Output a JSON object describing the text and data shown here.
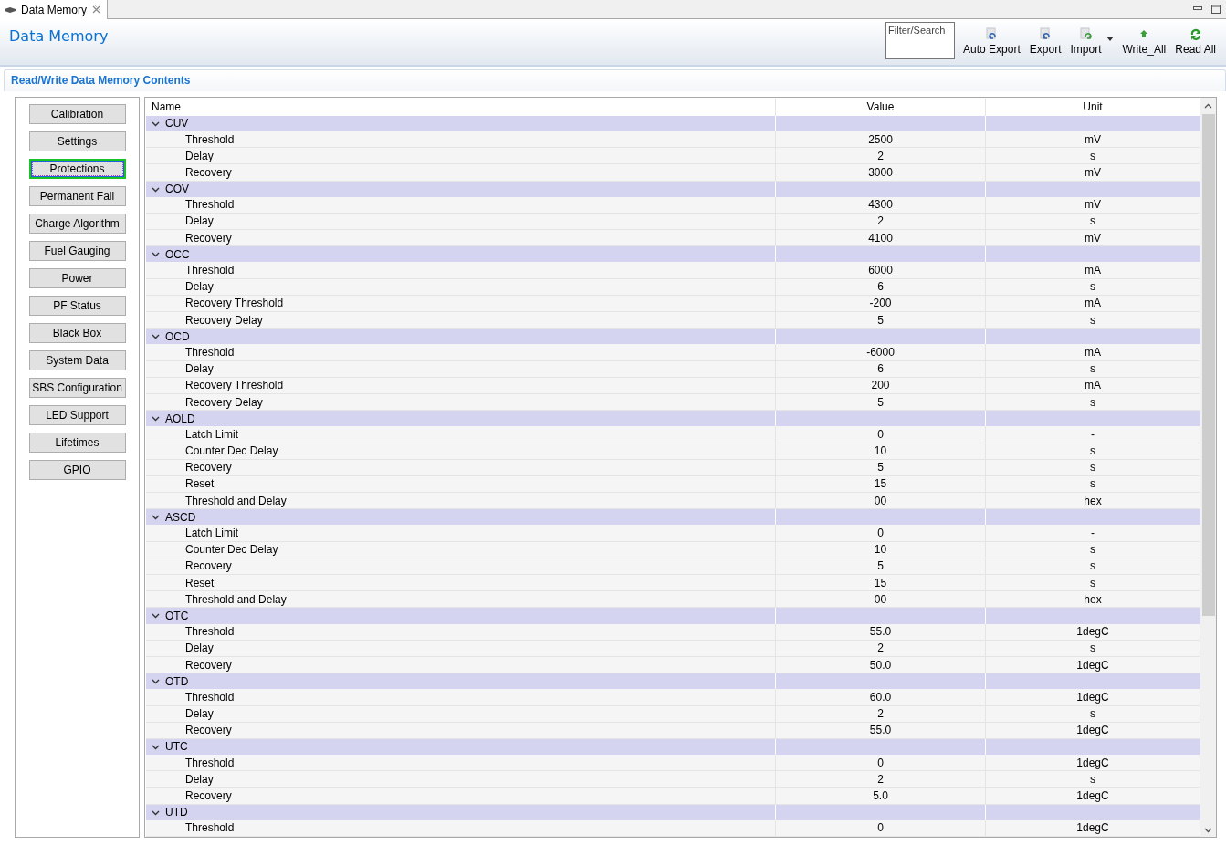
{
  "tab": {
    "title": "Data Memory",
    "selected": true
  },
  "header": {
    "title": "Data Memory"
  },
  "toolbar": {
    "search": {
      "placeholder": "Filter/Search"
    },
    "buttons": [
      {
        "label": "Auto Export",
        "kind": "export",
        "menu": false
      },
      {
        "label": "Export",
        "kind": "export",
        "menu": false
      },
      {
        "label": "Import",
        "kind": "import",
        "menu": true
      },
      {
        "label": "Write_All",
        "kind": "write",
        "menu": false
      },
      {
        "label": "Read All",
        "kind": "read",
        "menu": false
      }
    ]
  },
  "section": {
    "title": "Read/Write Data Memory Contents"
  },
  "sidebar": {
    "items": [
      {
        "label": "Calibration",
        "selected": false
      },
      {
        "label": "Settings",
        "selected": false
      },
      {
        "label": "Protections",
        "selected": true
      },
      {
        "label": "Permanent Fail",
        "selected": false
      },
      {
        "label": "Charge Algorithm",
        "selected": false
      },
      {
        "label": "Fuel Gauging",
        "selected": false
      },
      {
        "label": "Power",
        "selected": false
      },
      {
        "label": "PF Status",
        "selected": false
      },
      {
        "label": "Black Box",
        "selected": false
      },
      {
        "label": "System Data",
        "selected": false
      },
      {
        "label": "SBS Configuration",
        "selected": false
      },
      {
        "label": "LED Support",
        "selected": false
      },
      {
        "label": "Lifetimes",
        "selected": false
      },
      {
        "label": "GPIO",
        "selected": false
      }
    ]
  },
  "table": {
    "columns": [
      "Name",
      "Value",
      "Unit"
    ],
    "groups": [
      {
        "name": "CUV",
        "expanded": true,
        "children": [
          [
            "Threshold",
            "2500",
            "mV"
          ],
          [
            "Delay",
            "2",
            "s"
          ],
          [
            "Recovery",
            "3000",
            "mV"
          ]
        ]
      },
      {
        "name": "COV",
        "expanded": true,
        "children": [
          [
            "Threshold",
            "4300",
            "mV"
          ],
          [
            "Delay",
            "2",
            "s"
          ],
          [
            "Recovery",
            "4100",
            "mV"
          ]
        ]
      },
      {
        "name": "OCC",
        "expanded": true,
        "children": [
          [
            "Threshold",
            "6000",
            "mA"
          ],
          [
            "Delay",
            "6",
            "s"
          ],
          [
            "Recovery Threshold",
            "-200",
            "mA"
          ],
          [
            "Recovery Delay",
            "5",
            "s"
          ]
        ]
      },
      {
        "name": "OCD",
        "expanded": true,
        "children": [
          [
            "Threshold",
            "-6000",
            "mA"
          ],
          [
            "Delay",
            "6",
            "s"
          ],
          [
            "Recovery Threshold",
            "200",
            "mA"
          ],
          [
            "Recovery Delay",
            "5",
            "s"
          ]
        ]
      },
      {
        "name": "AOLD",
        "expanded": true,
        "children": [
          [
            "Latch Limit",
            "0",
            "-"
          ],
          [
            "Counter Dec Delay",
            "10",
            "s"
          ],
          [
            "Recovery",
            "5",
            "s"
          ],
          [
            "Reset",
            "15",
            "s"
          ],
          [
            "Threshold and Delay",
            "00",
            "hex"
          ]
        ]
      },
      {
        "name": "ASCD",
        "expanded": true,
        "children": [
          [
            "Latch Limit",
            "0",
            "-"
          ],
          [
            "Counter Dec Delay",
            "10",
            "s"
          ],
          [
            "Recovery",
            "5",
            "s"
          ],
          [
            "Reset",
            "15",
            "s"
          ],
          [
            "Threshold and Delay",
            "00",
            "hex"
          ]
        ]
      },
      {
        "name": "OTC",
        "expanded": true,
        "children": [
          [
            "Threshold",
            "55.0",
            "1degC"
          ],
          [
            "Delay",
            "2",
            "s"
          ],
          [
            "Recovery",
            "50.0",
            "1degC"
          ]
        ]
      },
      {
        "name": "OTD",
        "expanded": true,
        "children": [
          [
            "Threshold",
            "60.0",
            "1degC"
          ],
          [
            "Delay",
            "2",
            "s"
          ],
          [
            "Recovery",
            "55.0",
            "1degC"
          ]
        ]
      },
      {
        "name": "UTC",
        "expanded": true,
        "children": [
          [
            "Threshold",
            "0",
            "1degC"
          ],
          [
            "Delay",
            "2",
            "s"
          ],
          [
            "Recovery",
            "5.0",
            "1degC"
          ]
        ]
      },
      {
        "name": "UTD",
        "expanded": true,
        "children": [
          [
            "Threshold",
            "0",
            "1degC"
          ]
        ]
      }
    ]
  }
}
